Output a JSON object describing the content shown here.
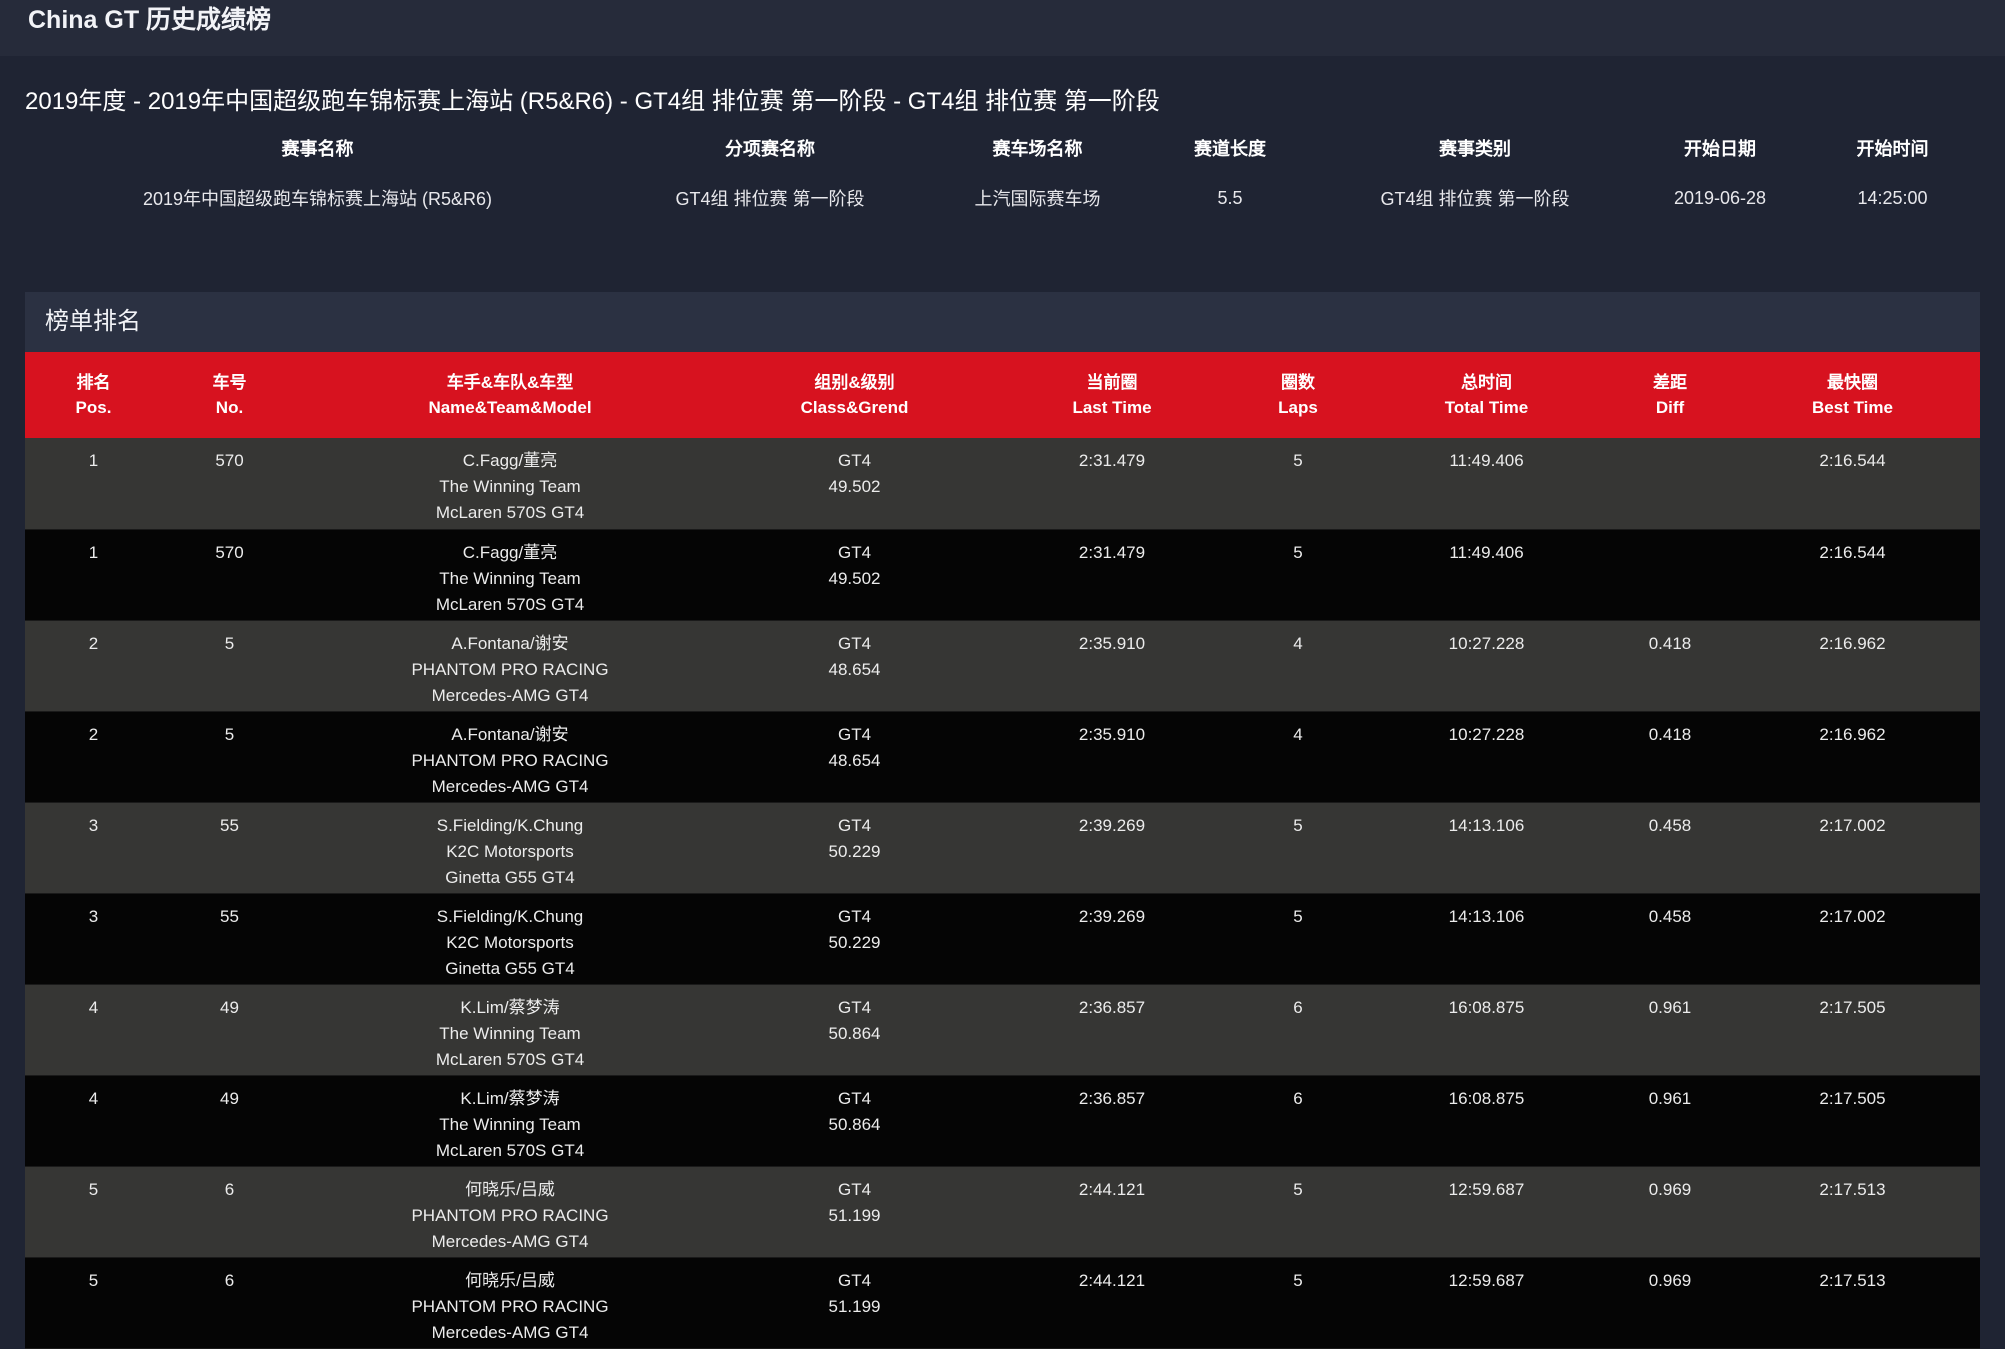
{
  "app": {
    "title": "China GT 历史成绩榜"
  },
  "race": {
    "title": "2019年度 - 2019年中国超级跑车锦标赛上海站 (R5&R6) - GT4组 排位赛 第一阶段 - GT4组 排位赛 第一阶段"
  },
  "info": {
    "headers": [
      "赛事名称",
      "分项赛名称",
      "赛车场名称",
      "赛道长度",
      "赛事类别",
      "开始日期",
      "开始时间"
    ],
    "values": [
      "2019年中国超级跑车锦标赛上海站 (R5&R6)",
      "GT4组 排位赛 第一阶段",
      "上汽国际赛车场",
      "5.5",
      "GT4组 排位赛 第一阶段",
      "2019-06-28",
      "14:25:00"
    ]
  },
  "ranking": {
    "title": "榜单排名",
    "columns": [
      {
        "zh": "排名",
        "en": "Pos."
      },
      {
        "zh": "车号",
        "en": "No."
      },
      {
        "zh": "车手&车队&车型",
        "en": "Name&Team&Model"
      },
      {
        "zh": "组别&级别",
        "en": "Class&Grend"
      },
      {
        "zh": "当前圈",
        "en": "Last Time"
      },
      {
        "zh": "圈数",
        "en": "Laps"
      },
      {
        "zh": "总时间",
        "en": "Total Time"
      },
      {
        "zh": "差距",
        "en": "Diff"
      },
      {
        "zh": "最快圈",
        "en": "Best Time"
      }
    ],
    "rows": [
      {
        "pos": "1",
        "no": "570",
        "driver": "C.Fagg/董亮",
        "team": "The Winning Team",
        "model": "McLaren 570S GT4",
        "cls": "GT4",
        "grade": "49.502",
        "last": "2:31.479",
        "laps": "5",
        "total": "11:49.406",
        "diff": "",
        "best": "2:16.544"
      },
      {
        "pos": "1",
        "no": "570",
        "driver": "C.Fagg/董亮",
        "team": "The Winning Team",
        "model": "McLaren 570S GT4",
        "cls": "GT4",
        "grade": "49.502",
        "last": "2:31.479",
        "laps": "5",
        "total": "11:49.406",
        "diff": "",
        "best": "2:16.544"
      },
      {
        "pos": "2",
        "no": "5",
        "driver": "A.Fontana/谢安",
        "team": "PHANTOM PRO RACING",
        "model": "Mercedes-AMG GT4",
        "cls": "GT4",
        "grade": "48.654",
        "last": "2:35.910",
        "laps": "4",
        "total": "10:27.228",
        "diff": "0.418",
        "best": "2:16.962"
      },
      {
        "pos": "2",
        "no": "5",
        "driver": "A.Fontana/谢安",
        "team": "PHANTOM PRO RACING",
        "model": "Mercedes-AMG GT4",
        "cls": "GT4",
        "grade": "48.654",
        "last": "2:35.910",
        "laps": "4",
        "total": "10:27.228",
        "diff": "0.418",
        "best": "2:16.962"
      },
      {
        "pos": "3",
        "no": "55",
        "driver": "S.Fielding/K.Chung",
        "team": "K2C Motorsports",
        "model": "Ginetta G55 GT4",
        "cls": "GT4",
        "grade": "50.229",
        "last": "2:39.269",
        "laps": "5",
        "total": "14:13.106",
        "diff": "0.458",
        "best": "2:17.002"
      },
      {
        "pos": "3",
        "no": "55",
        "driver": "S.Fielding/K.Chung",
        "team": "K2C Motorsports",
        "model": "Ginetta G55 GT4",
        "cls": "GT4",
        "grade": "50.229",
        "last": "2:39.269",
        "laps": "5",
        "total": "14:13.106",
        "diff": "0.458",
        "best": "2:17.002"
      },
      {
        "pos": "4",
        "no": "49",
        "driver": "K.Lim/蔡梦涛",
        "team": "The Winning Team",
        "model": "McLaren 570S GT4",
        "cls": "GT4",
        "grade": "50.864",
        "last": "2:36.857",
        "laps": "6",
        "total": "16:08.875",
        "diff": "0.961",
        "best": "2:17.505"
      },
      {
        "pos": "4",
        "no": "49",
        "driver": "K.Lim/蔡梦涛",
        "team": "The Winning Team",
        "model": "McLaren 570S GT4",
        "cls": "GT4",
        "grade": "50.864",
        "last": "2:36.857",
        "laps": "6",
        "total": "16:08.875",
        "diff": "0.961",
        "best": "2:17.505"
      },
      {
        "pos": "5",
        "no": "6",
        "driver": "何晓乐/吕威",
        "team": "PHANTOM PRO RACING",
        "model": "Mercedes-AMG GT4",
        "cls": "GT4",
        "grade": "51.199",
        "last": "2:44.121",
        "laps": "5",
        "total": "12:59.687",
        "diff": "0.969",
        "best": "2:17.513"
      },
      {
        "pos": "5",
        "no": "6",
        "driver": "何晓乐/吕威",
        "team": "PHANTOM PRO RACING",
        "model": "Mercedes-AMG GT4",
        "cls": "GT4",
        "grade": "51.199",
        "last": "2:44.121",
        "laps": "5",
        "total": "12:59.687",
        "diff": "0.969",
        "best": "2:17.513"
      }
    ]
  }
}
